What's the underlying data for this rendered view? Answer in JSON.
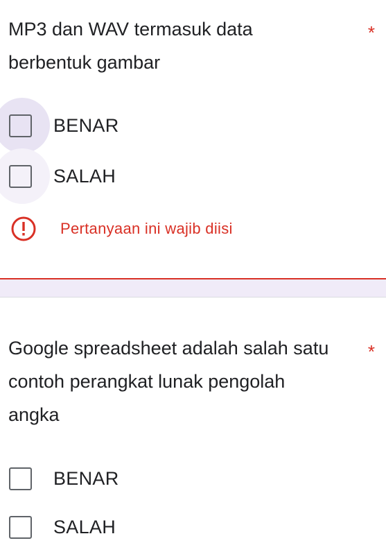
{
  "question1": {
    "title": "MP3 dan WAV termasuk data berbentuk gambar",
    "required_mark": "*",
    "options": [
      {
        "label": "BENAR",
        "checked": false
      },
      {
        "label": "SALAH",
        "checked": false
      }
    ],
    "error": {
      "icon": "error-icon",
      "text": "Pertanyaan ini wajib diisi"
    }
  },
  "question2": {
    "title": "Google spreadsheet adalah salah satu contoh perangkat lunak pengolah angka",
    "required_mark": "*",
    "options": [
      {
        "label": "BENAR",
        "checked": false
      },
      {
        "label": "SALAH",
        "checked": false
      }
    ]
  },
  "colors": {
    "error": "#d93025",
    "accent_light": "#f0ebf8",
    "text": "#202124",
    "checkbox_border": "#5f6368"
  }
}
